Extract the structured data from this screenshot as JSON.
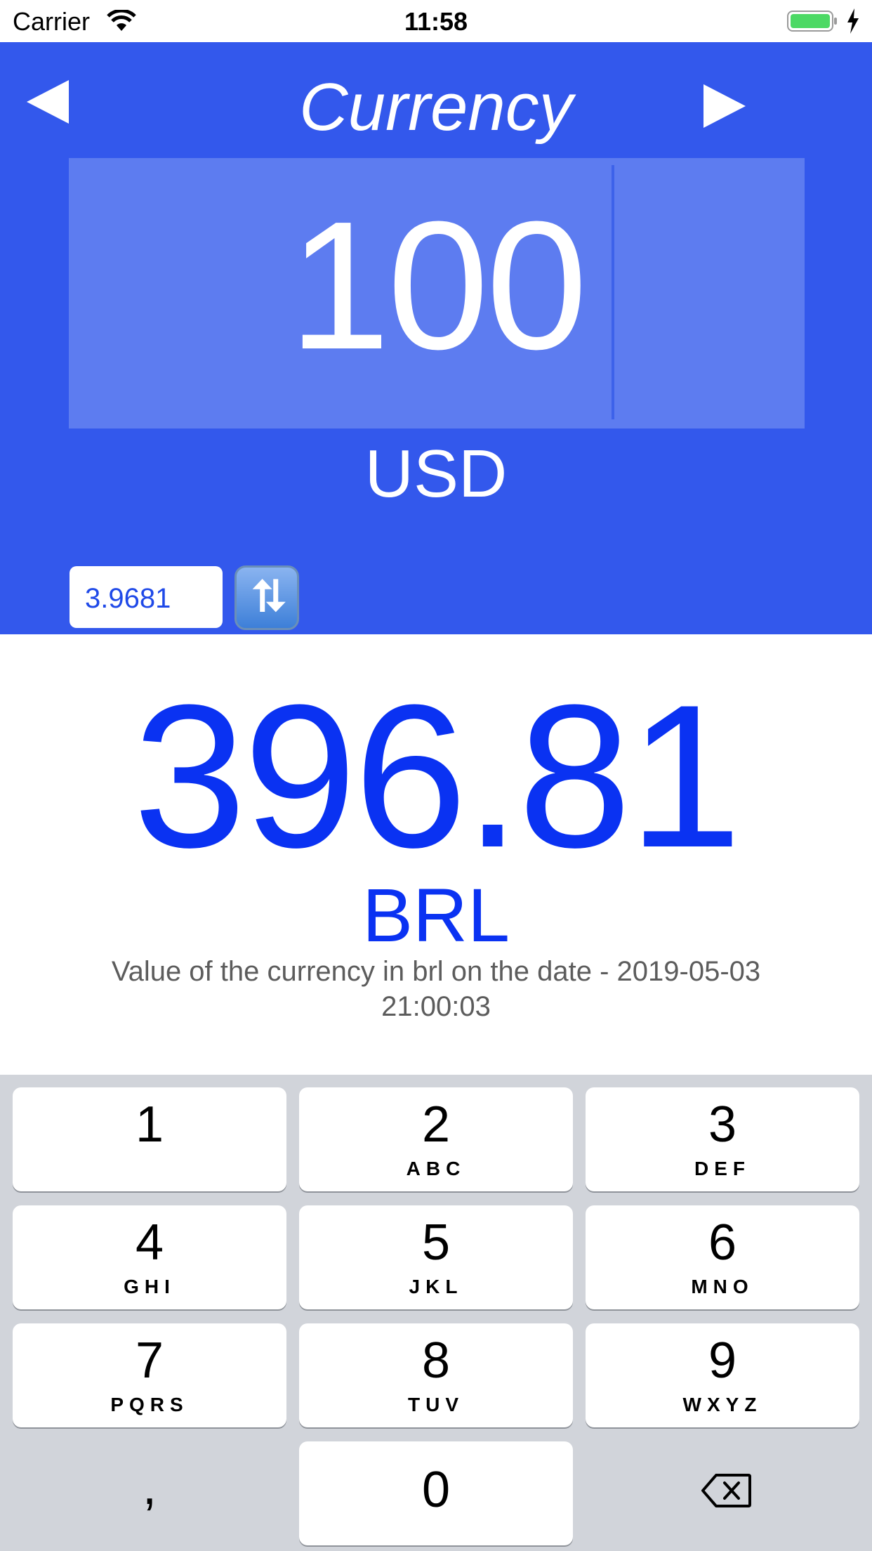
{
  "status_bar": {
    "carrier": "Carrier",
    "time": "11:58"
  },
  "header": {
    "title": "Currency",
    "prev_icon": "triangle-left-icon",
    "next_icon": "triangle-right-icon"
  },
  "input": {
    "amount": "100",
    "currency": "USD"
  },
  "rate": {
    "value": "3.9681",
    "swap_icon": "swap-arrows-icon"
  },
  "result": {
    "amount": "396.81",
    "currency": "BRL",
    "note": "Value of the currency in brl on the date - 2019-05-03 21:00:03"
  },
  "keypad": {
    "keys": [
      {
        "digit": "1",
        "letters": ""
      },
      {
        "digit": "2",
        "letters": "ABC"
      },
      {
        "digit": "3",
        "letters": "DEF"
      },
      {
        "digit": "4",
        "letters": "GHI"
      },
      {
        "digit": "5",
        "letters": "JKL"
      },
      {
        "digit": "6",
        "letters": "MNO"
      },
      {
        "digit": "7",
        "letters": "PQRS"
      },
      {
        "digit": "8",
        "letters": "TUV"
      },
      {
        "digit": "9",
        "letters": "WXYZ"
      },
      {
        "digit": "0",
        "letters": ""
      }
    ],
    "separator": ",",
    "delete_icon": "backspace-icon"
  },
  "colors": {
    "header": "#3358ec",
    "field": "#5d7cf0",
    "result": "#0a32f2",
    "keypad": "#d1d4da"
  }
}
